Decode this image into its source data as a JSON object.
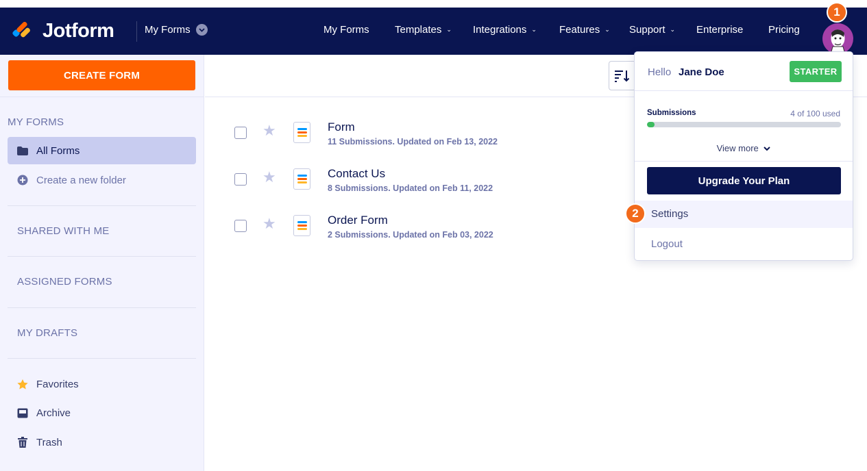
{
  "brand": {
    "name": "Jotform",
    "colors": {
      "navy": "#0a1551",
      "orange": "#ff6100",
      "green": "#3dbb5f",
      "badge": "#f26a1b"
    }
  },
  "header": {
    "workspace_switch": "My Forms",
    "nav": [
      {
        "label": "My Forms",
        "has_caret": false
      },
      {
        "label": "Templates",
        "has_caret": true
      },
      {
        "label": "Integrations",
        "has_caret": true
      },
      {
        "label": "Features",
        "has_caret": true
      },
      {
        "label": "Support",
        "has_caret": true
      },
      {
        "label": "Enterprise",
        "has_caret": false
      },
      {
        "label": "Pricing",
        "has_caret": false
      }
    ],
    "avatar_badge": "1"
  },
  "sidebar": {
    "create_button": "CREATE FORM",
    "my_forms_title": "MY FORMS",
    "all_forms": "All Forms",
    "create_folder": "Create a new folder",
    "shared_with_me": "SHARED WITH ME",
    "assigned_forms": "ASSIGNED FORMS",
    "my_drafts": "MY DRAFTS",
    "favorites": "Favorites",
    "archive": "Archive",
    "trash": "Trash"
  },
  "forms": [
    {
      "name": "Form",
      "meta": "11 Submissions. Updated on Feb 13, 2022"
    },
    {
      "name": "Contact Us",
      "meta": "8 Submissions. Updated on Feb 11, 2022"
    },
    {
      "name": "Order Form",
      "meta": "2 Submissions. Updated on Feb 03, 2022"
    }
  ],
  "account_menu": {
    "hello": "Hello",
    "user_name": "Jane Doe",
    "plan": "STARTER",
    "submissions_label": "Submissions",
    "submissions_used": "4 of 100 used",
    "submissions_fraction": 0.04,
    "view_more": "View more",
    "upgrade_button": "Upgrade Your Plan",
    "settings": "Settings",
    "settings_badge": "2",
    "logout": "Logout"
  }
}
